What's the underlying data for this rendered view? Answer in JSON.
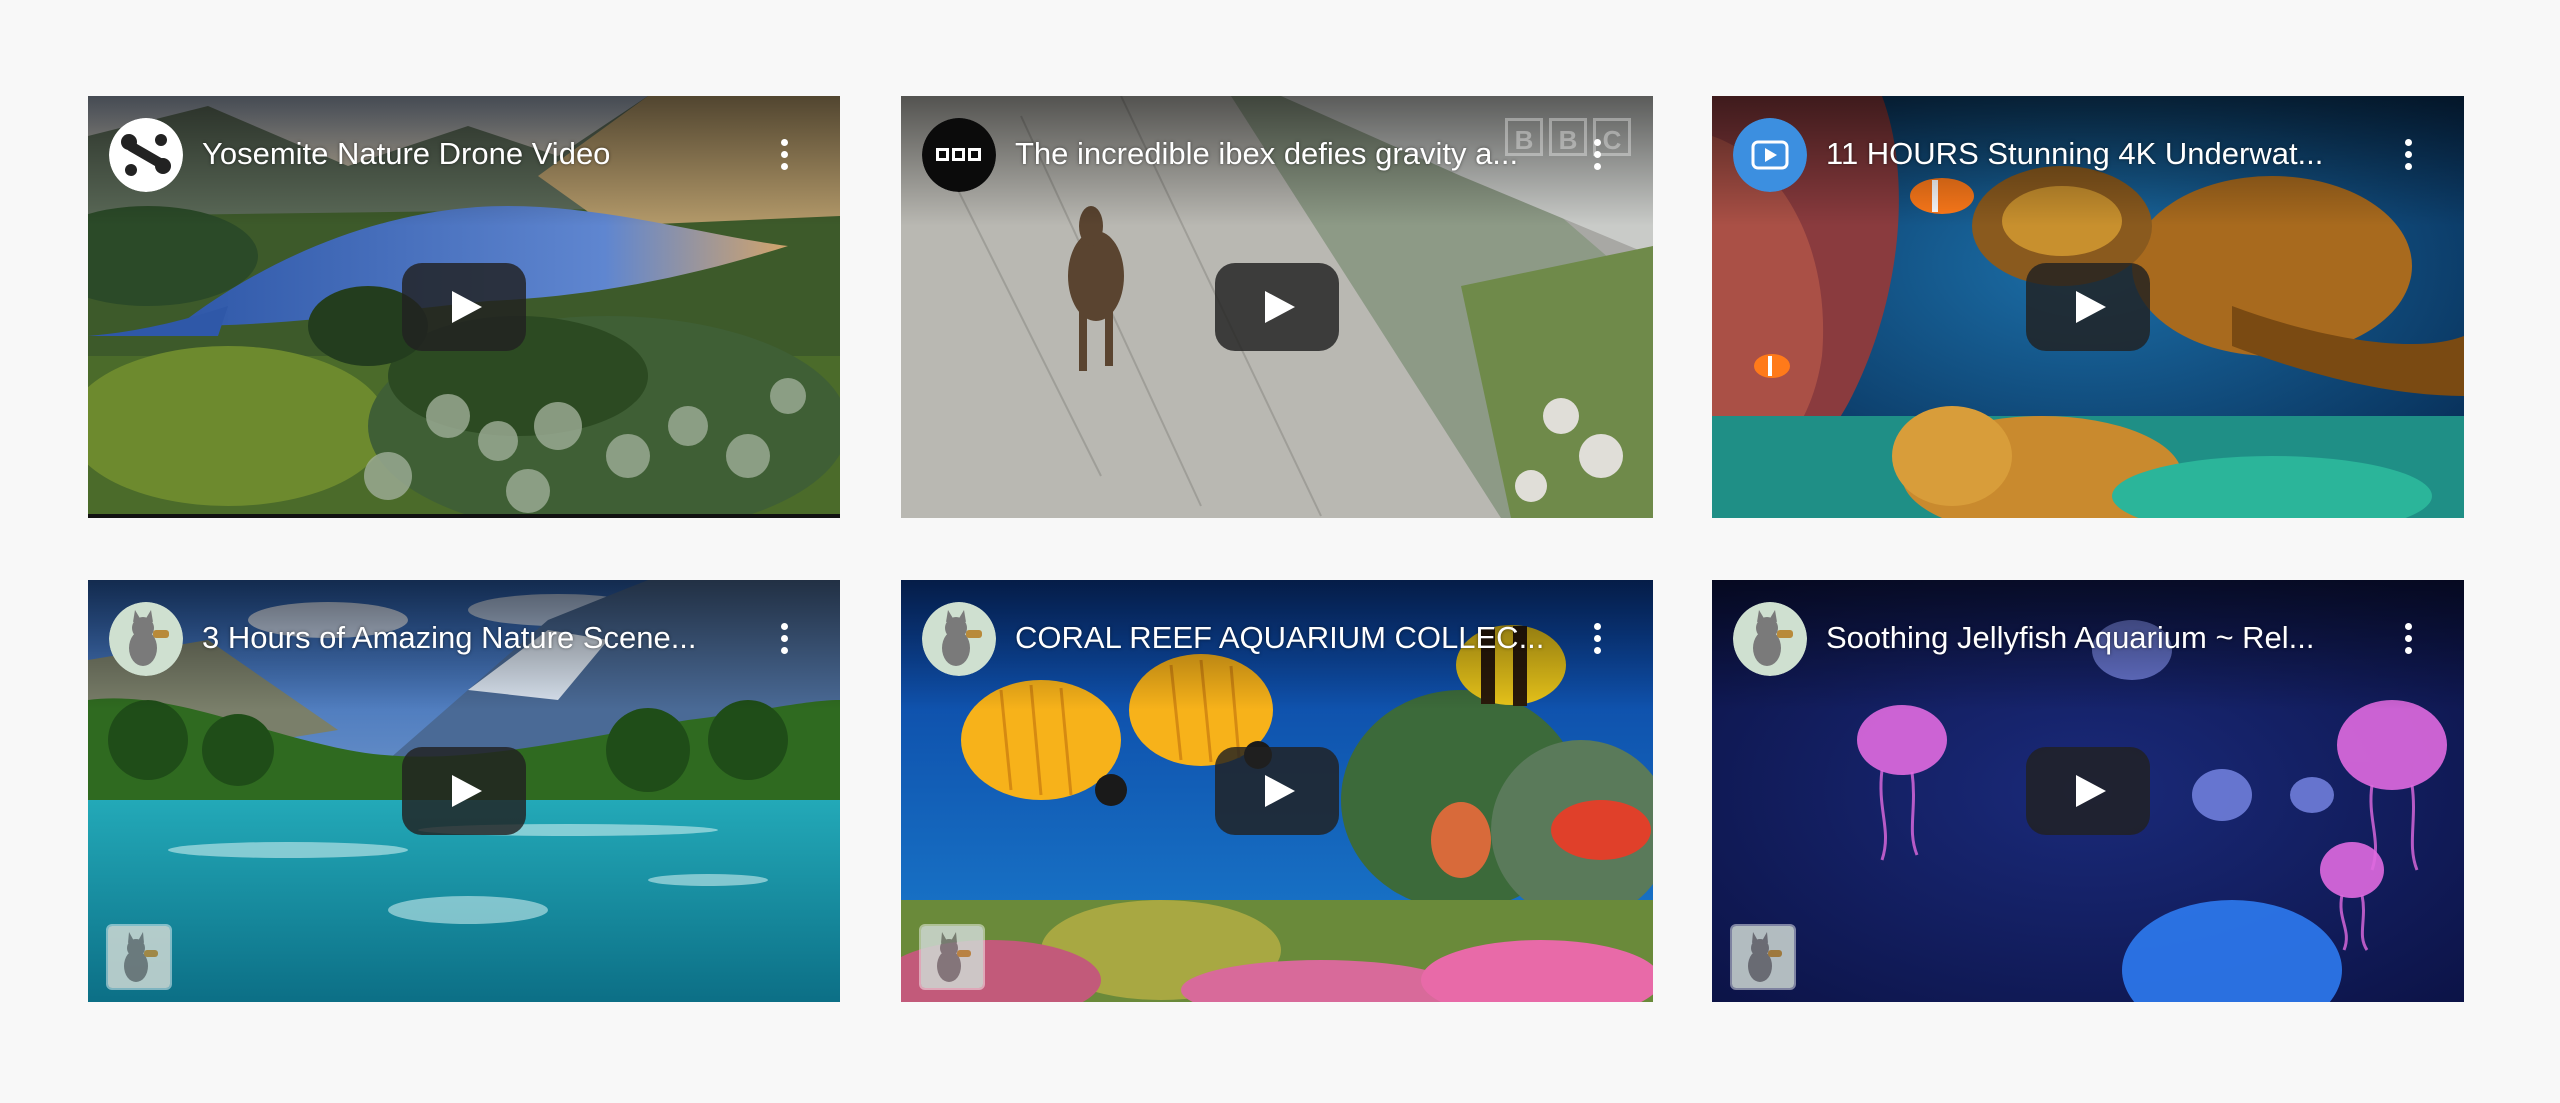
{
  "videos": [
    {
      "title": "Yosemite Nature Drone Video",
      "channel_icon": "drone-icon",
      "more_label": "More options",
      "play_label": "Play"
    },
    {
      "title": "The incredible ibex defies gravity a...",
      "channel_icon": "bbc-logo",
      "watermark": [
        "B",
        "B",
        "C"
      ],
      "more_label": "More options",
      "play_label": "Play"
    },
    {
      "title": "11 HOURS Stunning 4K Underwat...",
      "channel_icon": "relax-logo",
      "more_label": "More options",
      "play_label": "Play"
    },
    {
      "title": "3 Hours of Amazing Nature Scene...",
      "channel_icon": "cat-avatar",
      "more_label": "More options",
      "play_label": "Play"
    },
    {
      "title": "CORAL REEF AQUARIUM COLLEC...",
      "channel_icon": "cat-avatar",
      "more_label": "More options",
      "play_label": "Play"
    },
    {
      "title": "Soothing Jellyfish Aquarium ~ Rel...",
      "channel_icon": "cat-avatar",
      "more_label": "More options",
      "play_label": "Play"
    }
  ],
  "colors": {
    "page_bg": "#f8f8f8",
    "play_bg": "#212121",
    "title_text": "#ffffff"
  }
}
